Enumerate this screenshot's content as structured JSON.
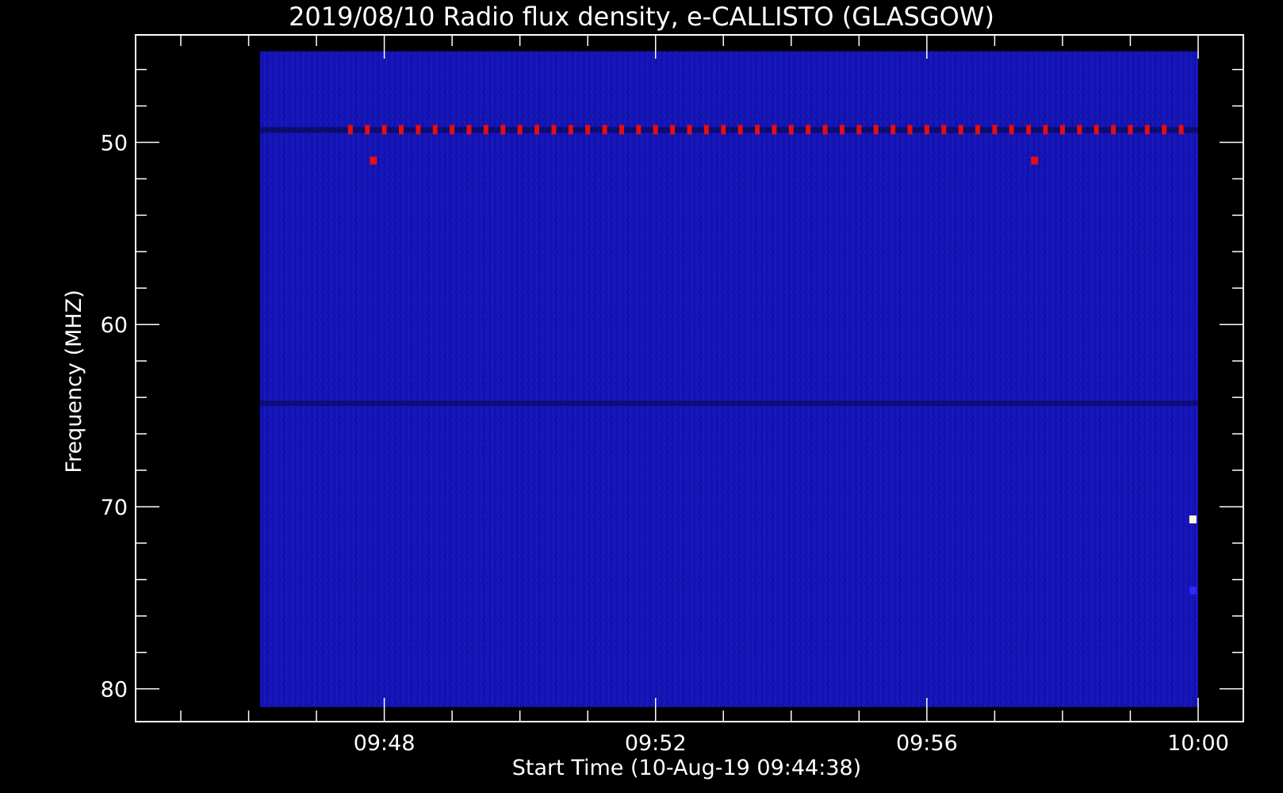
{
  "chart_data": {
    "type": "heatmap",
    "title": "2019/08/10  Radio flux density, e-CALLISTO (GLASGOW)",
    "xlabel": "Start Time (10-Aug-19 09:44:38)",
    "ylabel": "Frequency (MHZ)",
    "x_axis": {
      "unit": "time",
      "range": [
        "09:44:20",
        "10:00:40"
      ],
      "data_range": [
        "09:46:10",
        "10:00:00"
      ],
      "major_ticks": [
        "09:48",
        "09:52",
        "09:56",
        "10:00"
      ],
      "minor_tick_interval_min": 1
    },
    "y_axis": {
      "unit": "MHz",
      "range": [
        44.1,
        81.8
      ],
      "data_range": [
        45,
        81
      ],
      "inverted": true,
      "major_ticks": [
        50,
        60,
        70,
        80
      ],
      "minor_tick_interval": 2
    },
    "background_color": "#1414b4",
    "colors": {
      "axes": "#ffffff",
      "background": "#000000",
      "hot": "#e80c0c",
      "white_hot": "#fff8e0"
    },
    "features": {
      "periodic_line": {
        "frequency_mhz": 49.3,
        "start": "09:47:30",
        "end": "09:59:55",
        "period_sec": 15
      },
      "dark_band_mhz": [
        49.3,
        64.3
      ],
      "hot_spots": [
        {
          "time": "09:47:50",
          "frequency_mhz": 51.0,
          "color": "#e80c0c"
        },
        {
          "time": "09:57:35",
          "frequency_mhz": 51.0,
          "color": "#e80c0c"
        },
        {
          "time": "09:59:55",
          "frequency_mhz": 70.7,
          "color": "#fff8e0"
        },
        {
          "time": "09:59:55",
          "frequency_mhz": 74.6,
          "color": "#2a2aff"
        }
      ]
    }
  }
}
